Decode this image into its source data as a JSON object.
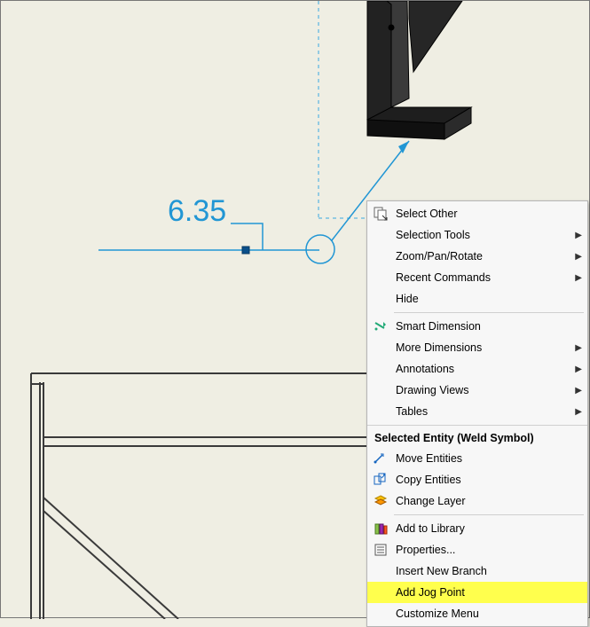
{
  "dimension_value": "6.35",
  "menu": {
    "group1": [
      {
        "label": "Select Other",
        "icon": "select-other-icon",
        "submenu": false
      },
      {
        "label": "Selection Tools",
        "icon": null,
        "submenu": true
      },
      {
        "label": "Zoom/Pan/Rotate",
        "icon": null,
        "submenu": true
      },
      {
        "label": "Recent Commands",
        "icon": null,
        "submenu": true
      },
      {
        "label": "Hide",
        "icon": null,
        "submenu": false
      }
    ],
    "group2": [
      {
        "label": "Smart Dimension",
        "icon": "smart-dimension-icon",
        "submenu": false
      },
      {
        "label": "More Dimensions",
        "icon": null,
        "submenu": true
      },
      {
        "label": "Annotations",
        "icon": null,
        "submenu": true
      },
      {
        "label": "Drawing Views",
        "icon": null,
        "submenu": true
      },
      {
        "label": "Tables",
        "icon": null,
        "submenu": true
      }
    ],
    "section_title": "Selected Entity (Weld Symbol)",
    "group3": [
      {
        "label": "Move Entities",
        "icon": "move-entities-icon",
        "submenu": false
      },
      {
        "label": "Copy Entities",
        "icon": "copy-entities-icon",
        "submenu": false
      },
      {
        "label": "Change Layer",
        "icon": "change-layer-icon",
        "submenu": false
      }
    ],
    "group4": [
      {
        "label": "Add to Library",
        "icon": "add-to-library-icon",
        "submenu": false
      },
      {
        "label": "Properties...",
        "icon": "properties-icon",
        "submenu": false
      },
      {
        "label": "Insert New Branch",
        "icon": null,
        "submenu": false
      },
      {
        "label": "Add Jog Point",
        "icon": null,
        "submenu": false,
        "highlight": true
      },
      {
        "label": "Customize Menu",
        "icon": null,
        "submenu": false
      }
    ]
  }
}
